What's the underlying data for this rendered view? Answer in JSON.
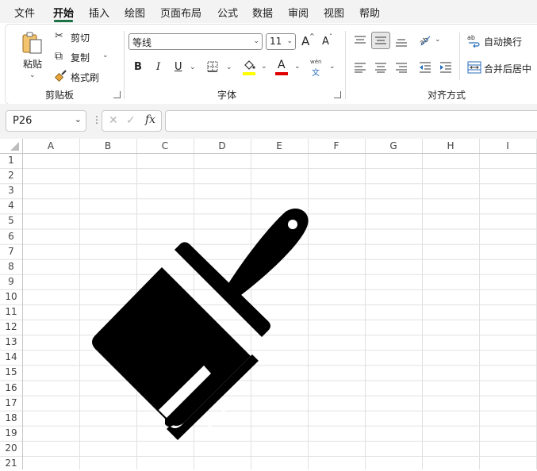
{
  "menu": {
    "items": [
      "文件",
      "开始",
      "插入",
      "绘图",
      "页面布局",
      "公式",
      "数据",
      "审阅",
      "视图",
      "帮助"
    ],
    "active_index": 1
  },
  "ribbon": {
    "clipboard": {
      "paste_label": "粘贴",
      "cut_label": "剪切",
      "copy_label": "复制",
      "format_painter_label": "格式刷",
      "group_label": "剪贴板"
    },
    "font": {
      "font_name": "等线",
      "font_size": "11",
      "grow_label": "A",
      "shrink_label": "A",
      "bold_label": "B",
      "italic_label": "I",
      "underline_label": "U",
      "font_color_label": "A",
      "phonetic_top": "wén",
      "phonetic_bottom": "文",
      "group_label": "字体",
      "fill_color": "#ffff00",
      "font_color": "#e00000"
    },
    "alignment": {
      "wrap_text_label": "自动换行",
      "merge_center_label": "合并后居中",
      "group_label": "对齐方式"
    }
  },
  "formula_bar": {
    "name_box": "P26",
    "cancel_symbol": "✕",
    "enter_symbol": "✓",
    "fx_label": "fx",
    "content": ""
  },
  "sheet": {
    "columns": [
      "A",
      "B",
      "C",
      "D",
      "E",
      "F",
      "G",
      "H",
      "I"
    ],
    "rows": [
      "1",
      "2",
      "3",
      "4",
      "5",
      "6",
      "7",
      "8",
      "9",
      "10",
      "11",
      "12",
      "13",
      "14",
      "15",
      "16",
      "17",
      "18",
      "19",
      "20",
      "21"
    ],
    "image_icon": "paintbrush-icon"
  }
}
